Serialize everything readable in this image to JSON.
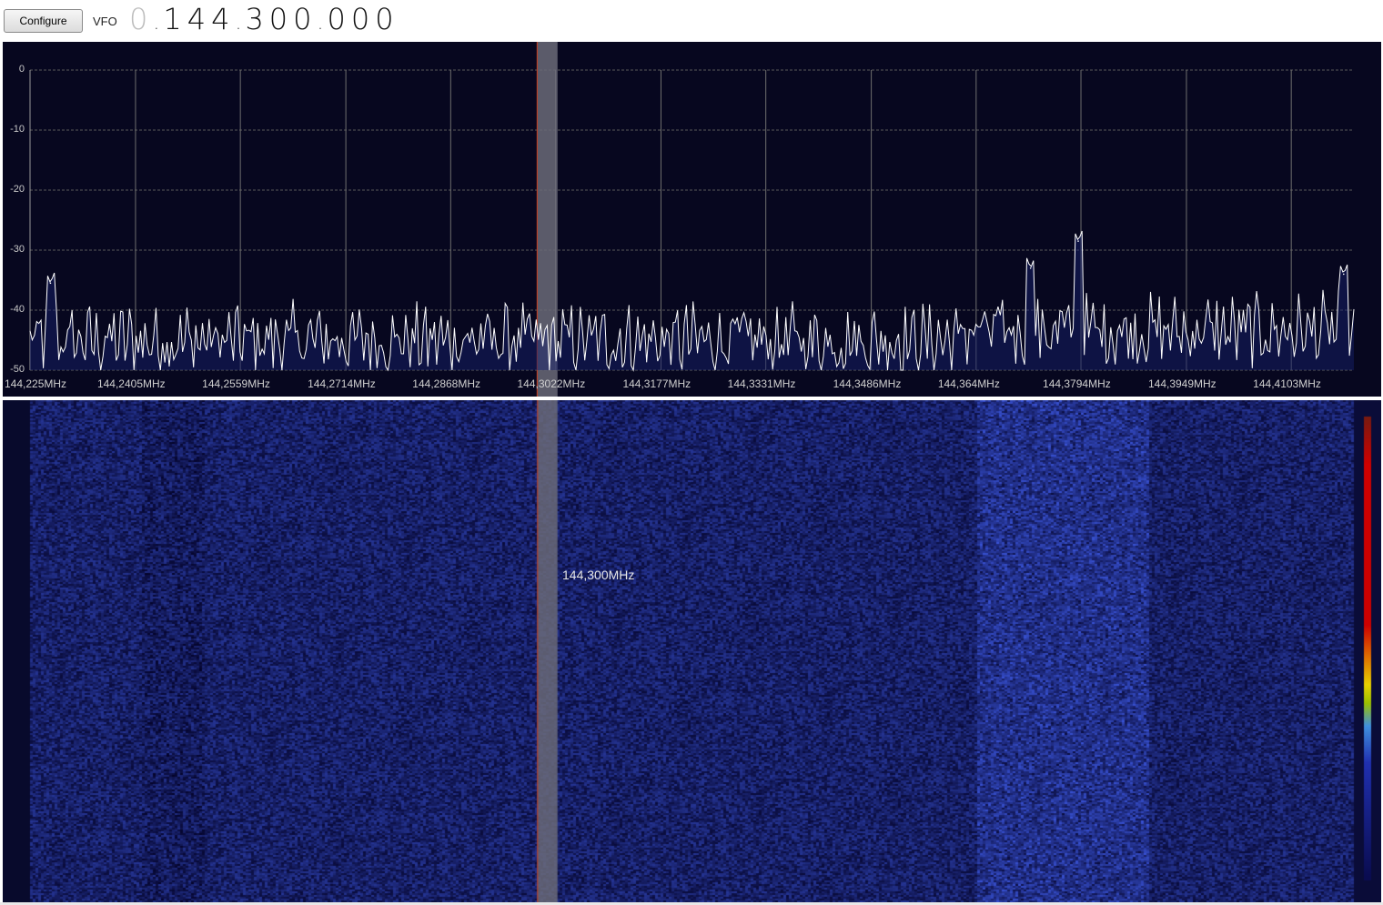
{
  "toolbar": {
    "configure_label": "Configure",
    "vfo_label": "VFO",
    "vfo_freq_dim": "0",
    "vfo_freq_parts": [
      "144",
      "300",
      "000"
    ]
  },
  "chart_data": {
    "type": "line",
    "title": "",
    "xlabel": "",
    "ylabel": "",
    "ylim": [
      -50,
      0
    ],
    "yticks": [
      "0",
      "-10",
      "-20",
      "-30",
      "-40",
      "-50"
    ],
    "xticks": [
      "144,225MHz",
      "144,2405MHz",
      "144,2559MHz",
      "144,2714MHz",
      "144,2868MHz",
      "144,3022MHz",
      "144,3177MHz",
      "144,3331MHz",
      "144,3486MHz",
      "144,364MHz",
      "144,3794MHz",
      "144,3949MHz",
      "144,4103MHz"
    ],
    "xtick_values": [
      144.225,
      144.2405,
      144.2559,
      144.2714,
      144.2868,
      144.3022,
      144.3177,
      144.3331,
      144.3486,
      144.364,
      144.3794,
      144.3949,
      144.4103
    ],
    "xlim": [
      144.225,
      144.4195
    ],
    "grid": true,
    "peaks": [
      {
        "x": 144.379,
        "y": -28.5
      },
      {
        "x": 144.372,
        "y": -33
      },
      {
        "x": 144.418,
        "y": -34
      },
      {
        "x": 144.228,
        "y": -35.5
      }
    ],
    "noise_floor": -45,
    "marker_band": [
      144.2995,
      144.3025
    ]
  },
  "waterfall": {
    "center_label": "144,300MHz"
  },
  "colors": {
    "background": "#07071f",
    "trace": "#ffffff",
    "grid_h": "#5a5a5a",
    "grid_v": "#6e6e6e",
    "marker_band": "#6a6a78",
    "marker_line": "#c83a1a"
  }
}
